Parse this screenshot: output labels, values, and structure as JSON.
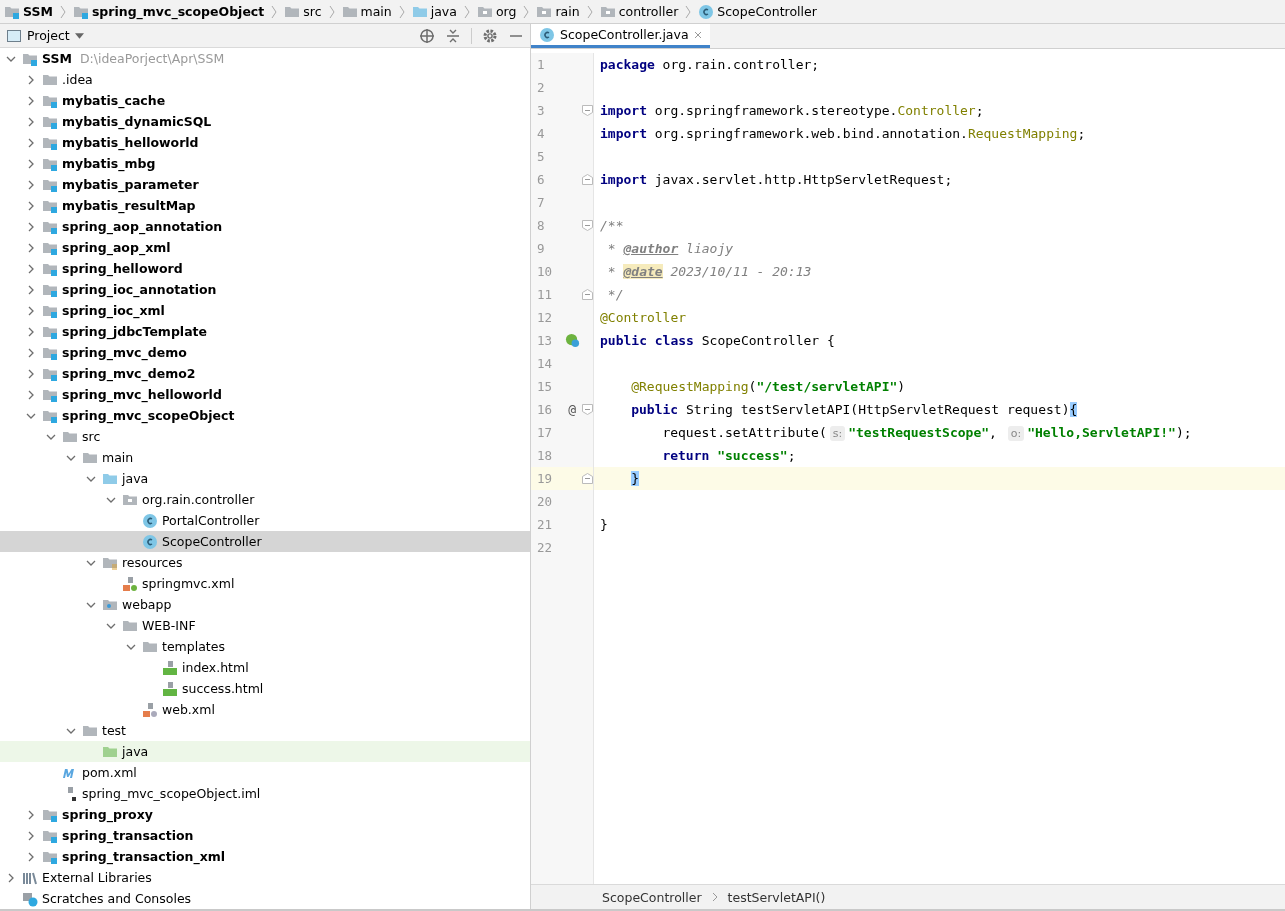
{
  "nav_bar": [
    {
      "label": "SSM",
      "kind": "module"
    },
    {
      "label": "spring_mvc_scopeObject",
      "kind": "module"
    },
    {
      "label": "src",
      "kind": "folder"
    },
    {
      "label": "main",
      "kind": "folder"
    },
    {
      "label": "java",
      "kind": "source-folder"
    },
    {
      "label": "org",
      "kind": "package"
    },
    {
      "label": "rain",
      "kind": "package"
    },
    {
      "label": "controller",
      "kind": "package"
    },
    {
      "label": "ScopeController",
      "kind": "class"
    }
  ],
  "project_panel": {
    "title": "Project",
    "tree": [
      {
        "label": "SSM",
        "hint": "D:\\ideaPorject\\Apr\\SSM",
        "kind": "module",
        "expanded": true,
        "selected": false,
        "hovered": false,
        "children": [
          {
            "label": ".idea",
            "kind": "folder",
            "expanded": false,
            "selected": false,
            "hovered": false
          },
          {
            "label": "mybatis_cache",
            "kind": "module",
            "expanded": false,
            "selected": false,
            "hovered": false
          },
          {
            "label": "mybatis_dynamicSQL",
            "kind": "module",
            "expanded": false,
            "selected": false,
            "hovered": false
          },
          {
            "label": "mybatis_helloworld",
            "kind": "module",
            "expanded": false,
            "selected": false,
            "hovered": false
          },
          {
            "label": "mybatis_mbg",
            "kind": "module",
            "expanded": false,
            "selected": false,
            "hovered": false
          },
          {
            "label": "mybatis_parameter",
            "kind": "module",
            "expanded": false,
            "selected": false,
            "hovered": false
          },
          {
            "label": "mybatis_resultMap",
            "kind": "module",
            "expanded": false,
            "selected": false,
            "hovered": false
          },
          {
            "label": "spring_aop_annotation",
            "kind": "module",
            "expanded": false,
            "selected": false,
            "hovered": false
          },
          {
            "label": "spring_aop_xml",
            "kind": "module",
            "expanded": false,
            "selected": false,
            "hovered": false
          },
          {
            "label": "spring_helloword",
            "kind": "module",
            "expanded": false,
            "selected": false,
            "hovered": false
          },
          {
            "label": "spring_ioc_annotation",
            "kind": "module",
            "expanded": false,
            "selected": false,
            "hovered": false
          },
          {
            "label": "spring_ioc_xml",
            "kind": "module",
            "expanded": false,
            "selected": false,
            "hovered": false
          },
          {
            "label": "spring_jdbcTemplate",
            "kind": "module",
            "expanded": false,
            "selected": false,
            "hovered": false
          },
          {
            "label": "spring_mvc_demo",
            "kind": "module",
            "expanded": false,
            "selected": false,
            "hovered": false
          },
          {
            "label": "spring_mvc_demo2",
            "kind": "module",
            "expanded": false,
            "selected": false,
            "hovered": false
          },
          {
            "label": "spring_mvc_helloworld",
            "kind": "module",
            "expanded": false,
            "selected": false,
            "hovered": false
          },
          {
            "label": "spring_mvc_scopeObject",
            "kind": "module",
            "expanded": true,
            "selected": false,
            "hovered": false,
            "children": [
              {
                "label": "src",
                "kind": "folder",
                "expanded": true,
                "selected": false,
                "hovered": false,
                "children": [
                  {
                    "label": "main",
                    "kind": "folder",
                    "expanded": true,
                    "selected": false,
                    "hovered": false,
                    "children": [
                      {
                        "label": "java",
                        "kind": "source-folder",
                        "expanded": true,
                        "selected": false,
                        "hovered": false,
                        "children": [
                          {
                            "label": "org.rain.controller",
                            "kind": "package",
                            "expanded": true,
                            "selected": false,
                            "hovered": false,
                            "children": [
                              {
                                "label": "PortalController",
                                "kind": "class",
                                "selected": false,
                                "hovered": false
                              },
                              {
                                "label": "ScopeController",
                                "kind": "class",
                                "selected": true,
                                "hovered": false
                              }
                            ]
                          }
                        ]
                      },
                      {
                        "label": "resources",
                        "kind": "resources",
                        "expanded": true,
                        "selected": false,
                        "hovered": false,
                        "children": [
                          {
                            "label": "springmvc.xml",
                            "kind": "spring-xml",
                            "selected": false,
                            "hovered": false
                          }
                        ]
                      },
                      {
                        "label": "webapp",
                        "kind": "webapp",
                        "expanded": true,
                        "selected": false,
                        "hovered": false,
                        "children": [
                          {
                            "label": "WEB-INF",
                            "kind": "folder",
                            "expanded": true,
                            "selected": false,
                            "hovered": false,
                            "children": [
                              {
                                "label": "templates",
                                "kind": "folder",
                                "expanded": true,
                                "selected": false,
                                "hovered": false,
                                "children": [
                                  {
                                    "label": "index.html",
                                    "kind": "html",
                                    "selected": false,
                                    "hovered": false
                                  },
                                  {
                                    "label": "success.html",
                                    "kind": "html",
                                    "selected": false,
                                    "hovered": false
                                  }
                                ]
                              },
                              {
                                "label": "web.xml",
                                "kind": "web-xml",
                                "selected": false,
                                "hovered": false
                              }
                            ]
                          }
                        ]
                      }
                    ]
                  },
                  {
                    "label": "test",
                    "kind": "folder",
                    "expanded": true,
                    "selected": false,
                    "hovered": false,
                    "children": [
                      {
                        "label": "java",
                        "kind": "test-folder",
                        "selected": false,
                        "hovered": true
                      }
                    ]
                  }
                ]
              },
              {
                "label": "pom.xml",
                "kind": "maven",
                "selected": false,
                "hovered": false
              },
              {
                "label": "spring_mvc_scopeObject.iml",
                "kind": "iml",
                "selected": false,
                "hovered": false
              }
            ]
          },
          {
            "label": "spring_proxy",
            "kind": "module",
            "expanded": false,
            "selected": false,
            "hovered": false
          },
          {
            "label": "spring_transaction",
            "kind": "module",
            "expanded": false,
            "selected": false,
            "hovered": false
          },
          {
            "label": "spring_transaction_xml",
            "kind": "module",
            "expanded": false,
            "selected": false,
            "hovered": false
          }
        ]
      },
      {
        "label": "External Libraries",
        "kind": "libraries",
        "expanded": false,
        "selected": false,
        "hovered": false
      },
      {
        "label": "Scratches and Consoles",
        "kind": "scratches",
        "selected": false,
        "hovered": false
      }
    ]
  },
  "editor": {
    "tabs": [
      {
        "label": "ScopeController.java",
        "selected": true
      }
    ],
    "lines": [
      {
        "number": "1",
        "current": false,
        "fold_start": false,
        "fold_end": false,
        "bean_marker": false,
        "tokens": [
          {
            "kind": "keyword",
            "text": "package"
          },
          {
            "kind": "plain",
            "text": " org.rain.controller;"
          }
        ]
      },
      {
        "number": "2",
        "current": false,
        "fold_start": false,
        "fold_end": false,
        "bean_marker": false
      },
      {
        "number": "3",
        "current": false,
        "fold_start": true,
        "fold_end": false,
        "bean_marker": false,
        "tokens": [
          {
            "kind": "keyword",
            "text": "import"
          },
          {
            "kind": "plain",
            "text": " org.springframework.stereotype."
          },
          {
            "kind": "class-ref",
            "text": "Controller"
          },
          {
            "kind": "plain",
            "text": ";"
          }
        ]
      },
      {
        "number": "4",
        "current": false,
        "fold_start": false,
        "fold_end": false,
        "bean_marker": false,
        "tokens": [
          {
            "kind": "keyword",
            "text": "import"
          },
          {
            "kind": "plain",
            "text": " org.springframework.web.bind.annotation."
          },
          {
            "kind": "class-ref",
            "text": "RequestMapping"
          },
          {
            "kind": "plain",
            "text": ";"
          }
        ]
      },
      {
        "number": "5",
        "current": false,
        "fold_start": false,
        "fold_end": false,
        "bean_marker": false
      },
      {
        "number": "6",
        "current": false,
        "fold_start": false,
        "fold_end": true,
        "bean_marker": false,
        "tokens": [
          {
            "kind": "keyword",
            "text": "import"
          },
          {
            "kind": "plain",
            "text": " javax.servlet.http.HttpServletRequest;"
          }
        ]
      },
      {
        "number": "7",
        "current": false,
        "fold_start": false,
        "fold_end": false,
        "bean_marker": false
      },
      {
        "number": "8",
        "current": false,
        "fold_start": true,
        "fold_end": false,
        "bean_marker": false,
        "tokens": [
          {
            "kind": "comment",
            "text": "/**"
          }
        ]
      },
      {
        "number": "9",
        "current": false,
        "fold_start": false,
        "fold_end": false,
        "bean_marker": false,
        "tokens": [
          {
            "kind": "comment",
            "text": " * "
          },
          {
            "kind": "doc-tag",
            "text": "@author"
          },
          {
            "kind": "comment",
            "text": " liaojy"
          }
        ]
      },
      {
        "number": "10",
        "current": false,
        "fold_start": false,
        "fold_end": false,
        "bean_marker": false,
        "tokens": [
          {
            "kind": "comment",
            "text": " * "
          },
          {
            "kind": "doc-tag-marked",
            "text": "@date"
          },
          {
            "kind": "comment",
            "text": " 2023/10/11 - 20:13"
          }
        ]
      },
      {
        "number": "11",
        "current": false,
        "fold_start": false,
        "fold_end": true,
        "bean_marker": false,
        "tokens": [
          {
            "kind": "comment",
            "text": " */"
          }
        ]
      },
      {
        "number": "12",
        "current": false,
        "fold_start": false,
        "fold_end": false,
        "bean_marker": false,
        "tokens": [
          {
            "kind": "annotation",
            "text": "@Controller"
          }
        ]
      },
      {
        "number": "13",
        "current": false,
        "fold_start": false,
        "fold_end": false,
        "bean_marker": true,
        "tokens": [
          {
            "kind": "keyword",
            "text": "public class"
          },
          {
            "kind": "plain",
            "text": " ScopeController {"
          }
        ],
        "children": [
          {
            "number": "14",
            "current": false,
            "fold_start": false,
            "fold_end": false,
            "bean_marker": false
          },
          {
            "number": "15",
            "current": false,
            "fold_start": false,
            "fold_end": false,
            "bean_marker": false,
            "tokens": [
              {
                "kind": "annotation",
                "text": "@RequestMapping"
              },
              {
                "kind": "plain",
                "text": "("
              },
              {
                "kind": "string",
                "text": "\"/test/servletAPI\""
              },
              {
                "kind": "plain",
                "text": ")"
              }
            ]
          },
          {
            "number": "16",
            "current": false,
            "fold_start": true,
            "fold_end": false,
            "bean_marker": false,
            "gutter_text": "@",
            "tokens": [
              {
                "kind": "keyword",
                "text": "public"
              },
              {
                "kind": "plain",
                "text": " String testServletAPI(HttpServletRequest request)"
              },
              {
                "kind": "matched-brace",
                "text": "{"
              }
            ],
            "children": [
              {
                "number": "17",
                "current": false,
                "fold_start": false,
                "fold_end": false,
                "bean_marker": false,
                "tokens": [
                  {
                    "kind": "plain",
                    "text": "request.setAttribute("
                  },
                  {
                    "kind": "hint",
                    "text": "s:"
                  },
                  {
                    "kind": "string",
                    "text": "\"testRequestScope\""
                  },
                  {
                    "kind": "plain",
                    "text": ", "
                  },
                  {
                    "kind": "hint",
                    "text": "o:"
                  },
                  {
                    "kind": "string",
                    "text": "\"Hello,ServletAPI!\""
                  },
                  {
                    "kind": "plain",
                    "text": ");"
                  }
                ]
              },
              {
                "number": "18",
                "current": false,
                "fold_start": false,
                "fold_end": false,
                "bean_marker": false,
                "tokens": [
                  {
                    "kind": "keyword",
                    "text": "return"
                  },
                  {
                    "kind": "string",
                    "text": " \"success\""
                  },
                  {
                    "kind": "plain",
                    "text": ";"
                  }
                ]
              }
            ]
          },
          {
            "number": "19",
            "current": true,
            "fold_start": false,
            "fold_end": true,
            "bean_marker": false,
            "tokens": [
              {
                "kind": "matched-brace",
                "text": "}"
              }
            ]
          },
          {
            "number": "20",
            "current": false,
            "fold_start": false,
            "fold_end": false,
            "bean_marker": false
          }
        ]
      },
      {
        "number": "21",
        "current": false,
        "fold_start": false,
        "fold_end": false,
        "bean_marker": false,
        "tokens": [
          {
            "kind": "plain",
            "text": "}"
          }
        ]
      },
      {
        "number": "22",
        "current": false,
        "fold_start": false,
        "fold_end": false,
        "bean_marker": false
      }
    ],
    "breadcrumbs": [
      "ScopeController",
      "testServletAPI()"
    ]
  }
}
